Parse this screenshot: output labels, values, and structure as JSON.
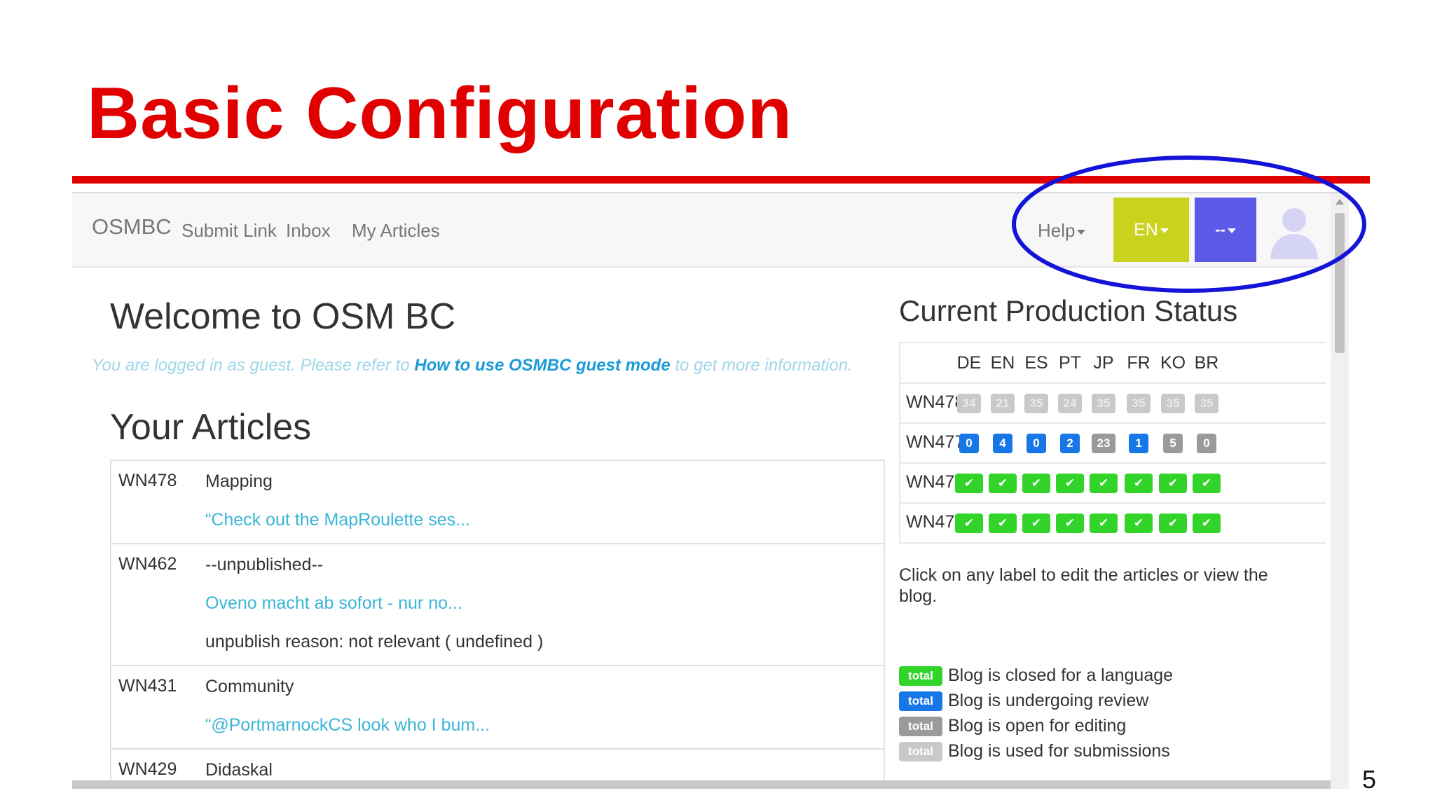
{
  "slide": {
    "title": "Basic Configuration",
    "page_number": "5"
  },
  "navbar": {
    "brand": "OSMBC",
    "links": [
      "Submit Link",
      "Inbox",
      "My Articles"
    ],
    "help_label": "Help",
    "language_label": "EN",
    "user_label": "--"
  },
  "welcome": {
    "heading": "Welcome to OSM BC",
    "guest_prefix": "You are logged in as guest. Please refer to ",
    "guest_link": "How to use OSMBC guest mode",
    "guest_suffix": " to get more information."
  },
  "articles": {
    "heading": "Your Articles",
    "rows": [
      {
        "id": "WN478",
        "lines": [
          {
            "text": "Mapping",
            "link": false
          },
          {
            "text": "“Check out the MapRoulette ses...",
            "link": true
          }
        ]
      },
      {
        "id": "WN462",
        "lines": [
          {
            "text": "--unpublished--",
            "link": false
          },
          {
            "text": "Oveno macht ab sofort - nur no...",
            "link": true
          },
          {
            "text": "unpublish reason: not relevant ( undefined )",
            "link": false
          }
        ]
      },
      {
        "id": "WN431",
        "lines": [
          {
            "text": "Community",
            "link": false
          },
          {
            "text": "“@PortmarnockCS look who I bum...",
            "link": true
          }
        ]
      },
      {
        "id": "WN429",
        "lines": [
          {
            "text": "Didaskal",
            "link": false
          }
        ]
      }
    ]
  },
  "status": {
    "heading": "Current Production Status",
    "languages": [
      "DE",
      "EN",
      "ES",
      "PT",
      "JP",
      "FR",
      "KO",
      "BR"
    ],
    "rows": [
      {
        "id": "WN478",
        "cells": [
          {
            "v": "34",
            "s": "grey"
          },
          {
            "v": "21",
            "s": "grey"
          },
          {
            "v": "35",
            "s": "grey"
          },
          {
            "v": "24",
            "s": "grey"
          },
          {
            "v": "35",
            "s": "grey"
          },
          {
            "v": "35",
            "s": "grey"
          },
          {
            "v": "35",
            "s": "grey"
          },
          {
            "v": "35",
            "s": "grey"
          }
        ]
      },
      {
        "id": "WN477",
        "cells": [
          {
            "v": "0",
            "s": "blue"
          },
          {
            "v": "4",
            "s": "blue"
          },
          {
            "v": "0",
            "s": "blue"
          },
          {
            "v": "2",
            "s": "blue"
          },
          {
            "v": "23",
            "s": "dgrey"
          },
          {
            "v": "1",
            "s": "blue"
          },
          {
            "v": "5",
            "s": "dgrey"
          },
          {
            "v": "0",
            "s": "dgrey"
          }
        ]
      },
      {
        "id": "WN476",
        "cells": [
          {
            "v": "✔",
            "s": "green"
          },
          {
            "v": "✔",
            "s": "green"
          },
          {
            "v": "✔",
            "s": "green"
          },
          {
            "v": "✔",
            "s": "green"
          },
          {
            "v": "✔",
            "s": "green"
          },
          {
            "v": "✔",
            "s": "green"
          },
          {
            "v": "✔",
            "s": "green"
          },
          {
            "v": "✔",
            "s": "green"
          }
        ]
      },
      {
        "id": "WN475",
        "cells": [
          {
            "v": "✔",
            "s": "green"
          },
          {
            "v": "✔",
            "s": "green"
          },
          {
            "v": "✔",
            "s": "green"
          },
          {
            "v": "✔",
            "s": "green"
          },
          {
            "v": "✔",
            "s": "green"
          },
          {
            "v": "✔",
            "s": "green"
          },
          {
            "v": "✔",
            "s": "green"
          },
          {
            "v": "✔",
            "s": "green"
          }
        ]
      }
    ],
    "legend_intro": "Click on any label to edit the articles or view the blog.",
    "legend": [
      {
        "badge": "total",
        "s": "green",
        "text": "Blog is closed for a language"
      },
      {
        "badge": "total",
        "s": "blue",
        "text": "Blog is undergoing review"
      },
      {
        "badge": "total",
        "s": "dgrey",
        "text": "Blog is open for editing"
      },
      {
        "badge": "total",
        "s": "grey",
        "text": "Blog is used for submissions"
      }
    ]
  },
  "colors": {
    "title_red": "#e10000",
    "highlight_blue": "#1414d8",
    "language_button": "#c9d21c",
    "user_button": "#5b59e6",
    "status_green": "#33d42a",
    "status_blue": "#1877e6"
  }
}
